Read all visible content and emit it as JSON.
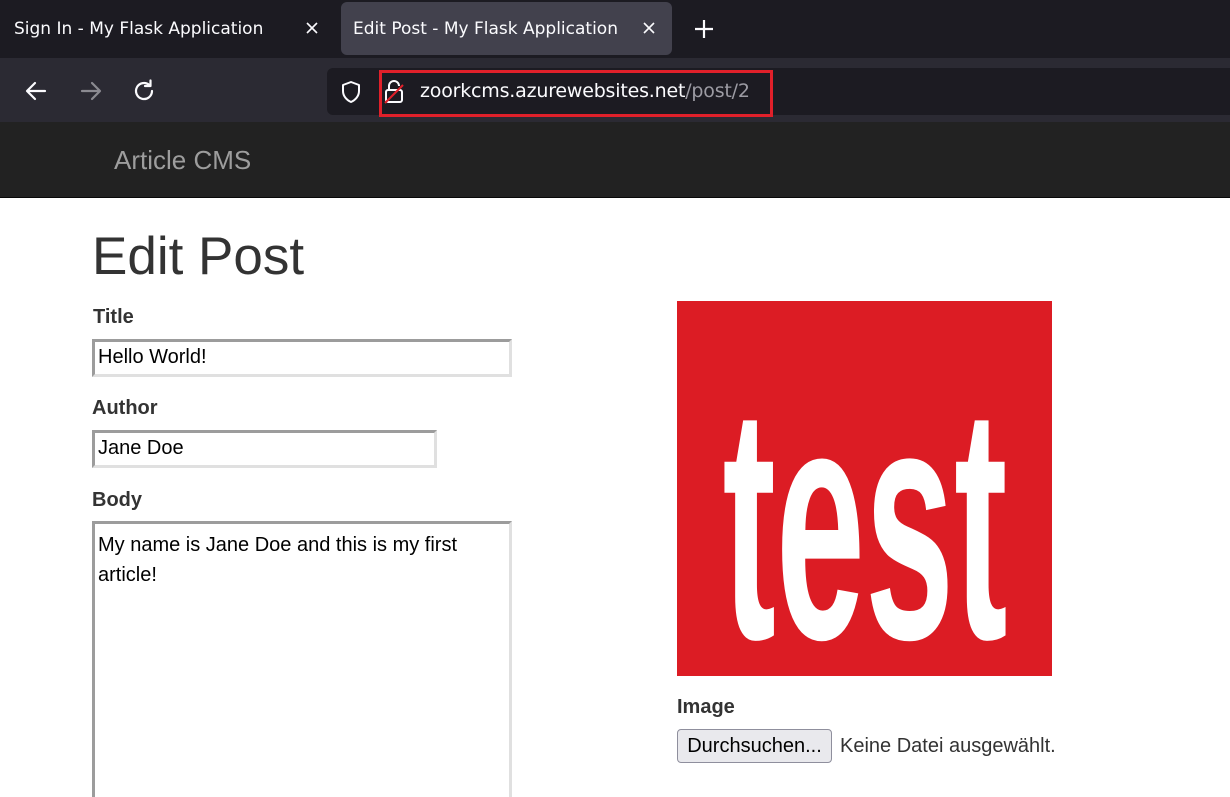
{
  "browser": {
    "tabs": [
      {
        "title": "Sign In - My Flask Application",
        "active": false
      },
      {
        "title": "Edit Post - My Flask Application",
        "active": true
      }
    ],
    "url": {
      "host": "zoorkcms.azurewebsites.net",
      "path": "/post/2"
    },
    "colors": {
      "tabstrip": "#1c1b22",
      "toolbar": "#2b2a33",
      "active_tab": "#42414d",
      "highlight": "#e0202a"
    }
  },
  "site": {
    "brand": "Article CMS"
  },
  "form": {
    "heading": "Edit Post",
    "title_label": "Title",
    "title_value": "Hello World!",
    "author_label": "Author",
    "author_value": "Jane Doe",
    "body_label": "Body",
    "body_value": "My name is Jane Doe and this is my first article!",
    "image_label": "Image",
    "image_text": "test",
    "file_button": "Durchsuchen...",
    "file_status": "Keine Datei ausgewählt."
  },
  "icons": [
    "close-icon",
    "plus-icon",
    "back-icon",
    "forward-icon",
    "reload-icon",
    "shield-icon",
    "lock-icon"
  ]
}
